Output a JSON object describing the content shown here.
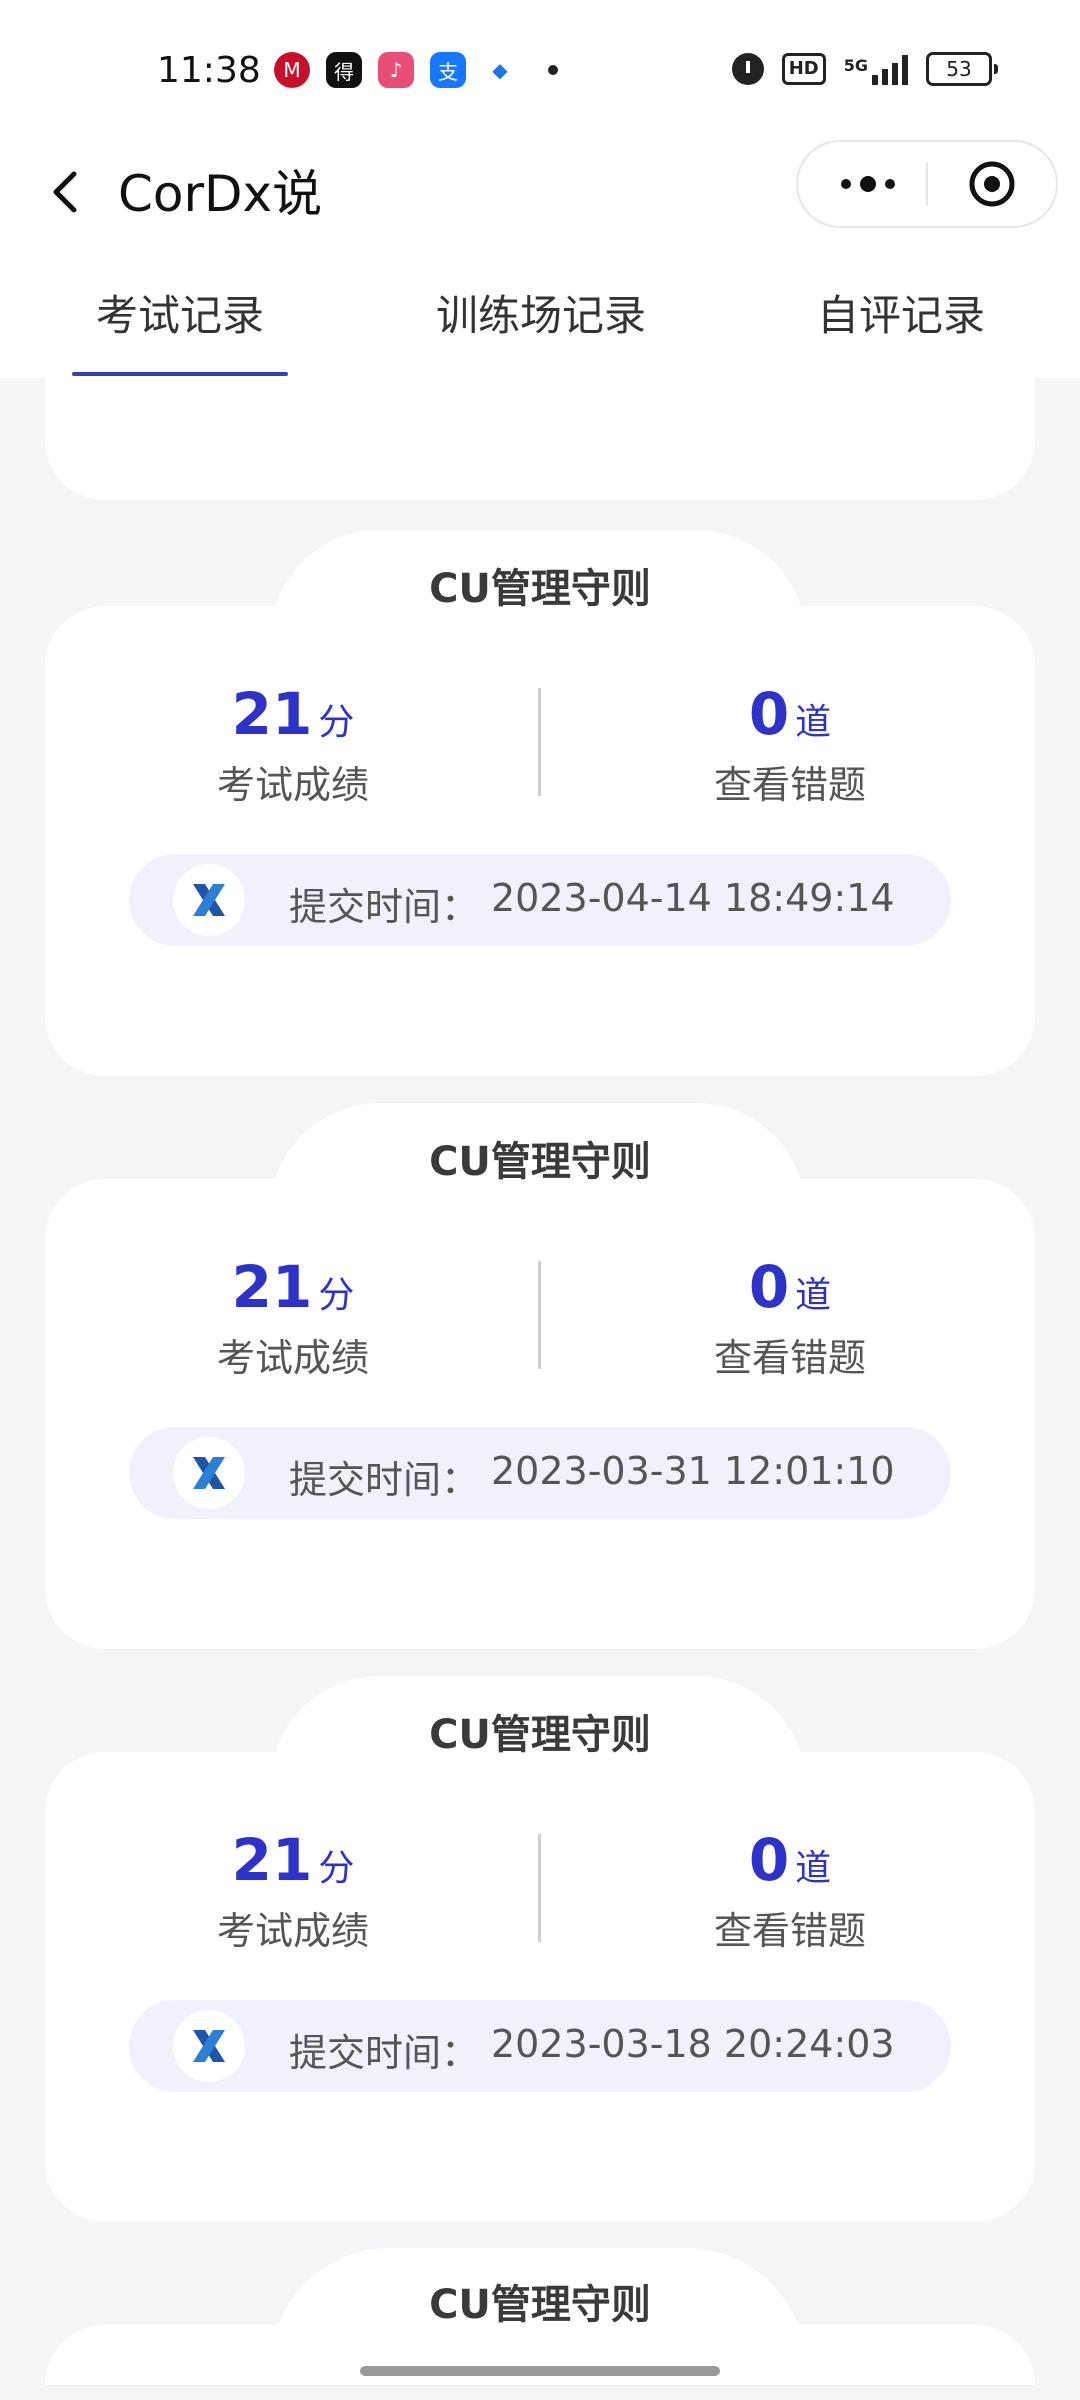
{
  "status_bar": {
    "time": "11:38",
    "network": "5G",
    "hd_label": "HD",
    "battery": "53"
  },
  "nav": {
    "title": "CorDx说"
  },
  "tabs": [
    {
      "label": "考试记录",
      "active": true
    },
    {
      "label": "训练场记录",
      "active": false
    },
    {
      "label": "自评记录",
      "active": false
    }
  ],
  "records": [
    {
      "title": "CU管理守则",
      "score": "21",
      "score_unit": "分",
      "score_label": "考试成绩",
      "wrong": "0",
      "wrong_unit": "道",
      "wrong_label": "查看错题",
      "submit_label": "提交时间：",
      "submit_time": "2023-04-14 18:49:14"
    },
    {
      "title": "CU管理守则",
      "score": "21",
      "score_unit": "分",
      "score_label": "考试成绩",
      "wrong": "0",
      "wrong_unit": "道",
      "wrong_label": "查看错题",
      "submit_label": "提交时间：",
      "submit_time": "2023-03-31 12:01:10"
    },
    {
      "title": "CU管理守则",
      "score": "21",
      "score_unit": "分",
      "score_label": "考试成绩",
      "wrong": "0",
      "wrong_unit": "道",
      "wrong_label": "查看错题",
      "submit_label": "提交时间：",
      "submit_time": "2023-03-18 20:24:03"
    }
  ],
  "partial_record": {
    "title": "CU管理守则"
  },
  "colors": {
    "accent": "#2d33c8",
    "tab_underline": "#3140b8",
    "background": "#f5f5f7"
  }
}
